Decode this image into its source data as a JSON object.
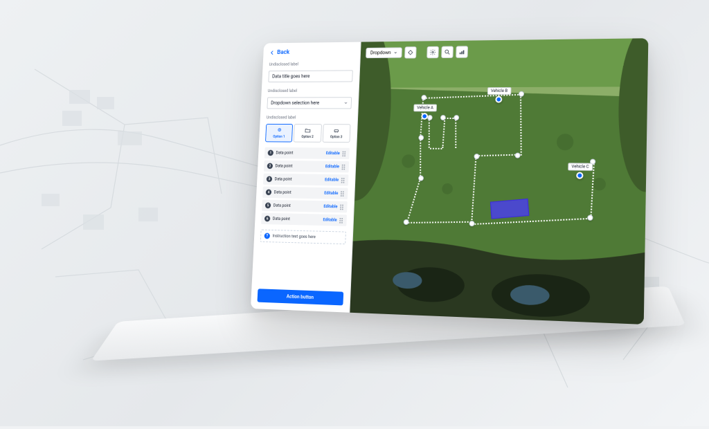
{
  "nav": {
    "back_label": "Back"
  },
  "form": {
    "title_label": "Undisclosed label",
    "title_value": "Data title goes here",
    "dropdown_label": "Undisclosed label",
    "dropdown_value": "Dropdown selection here",
    "segment_label": "Undisclosed label",
    "segments": [
      {
        "label": "Option 1"
      },
      {
        "label": "Option 2"
      },
      {
        "label": "Option 3"
      }
    ]
  },
  "data_points": [
    {
      "num": "1",
      "label": "Data point",
      "action": "Editable"
    },
    {
      "num": "2",
      "label": "Data point",
      "action": "Editable"
    },
    {
      "num": "3",
      "label": "Data point",
      "action": "Editable"
    },
    {
      "num": "4",
      "label": "Data point",
      "action": "Editable"
    },
    {
      "num": "5",
      "label": "Data point",
      "action": "Editable"
    },
    {
      "num": "6",
      "label": "Data point",
      "action": "Editable"
    }
  ],
  "instruction": "Instruction text goes here",
  "action_button": "Action button",
  "toolbar": {
    "dropdown": "Dropdown"
  },
  "vehicles": [
    {
      "name": "Vehicle A"
    },
    {
      "name": "Vehicle B"
    },
    {
      "name": "Vehicle C"
    }
  ]
}
